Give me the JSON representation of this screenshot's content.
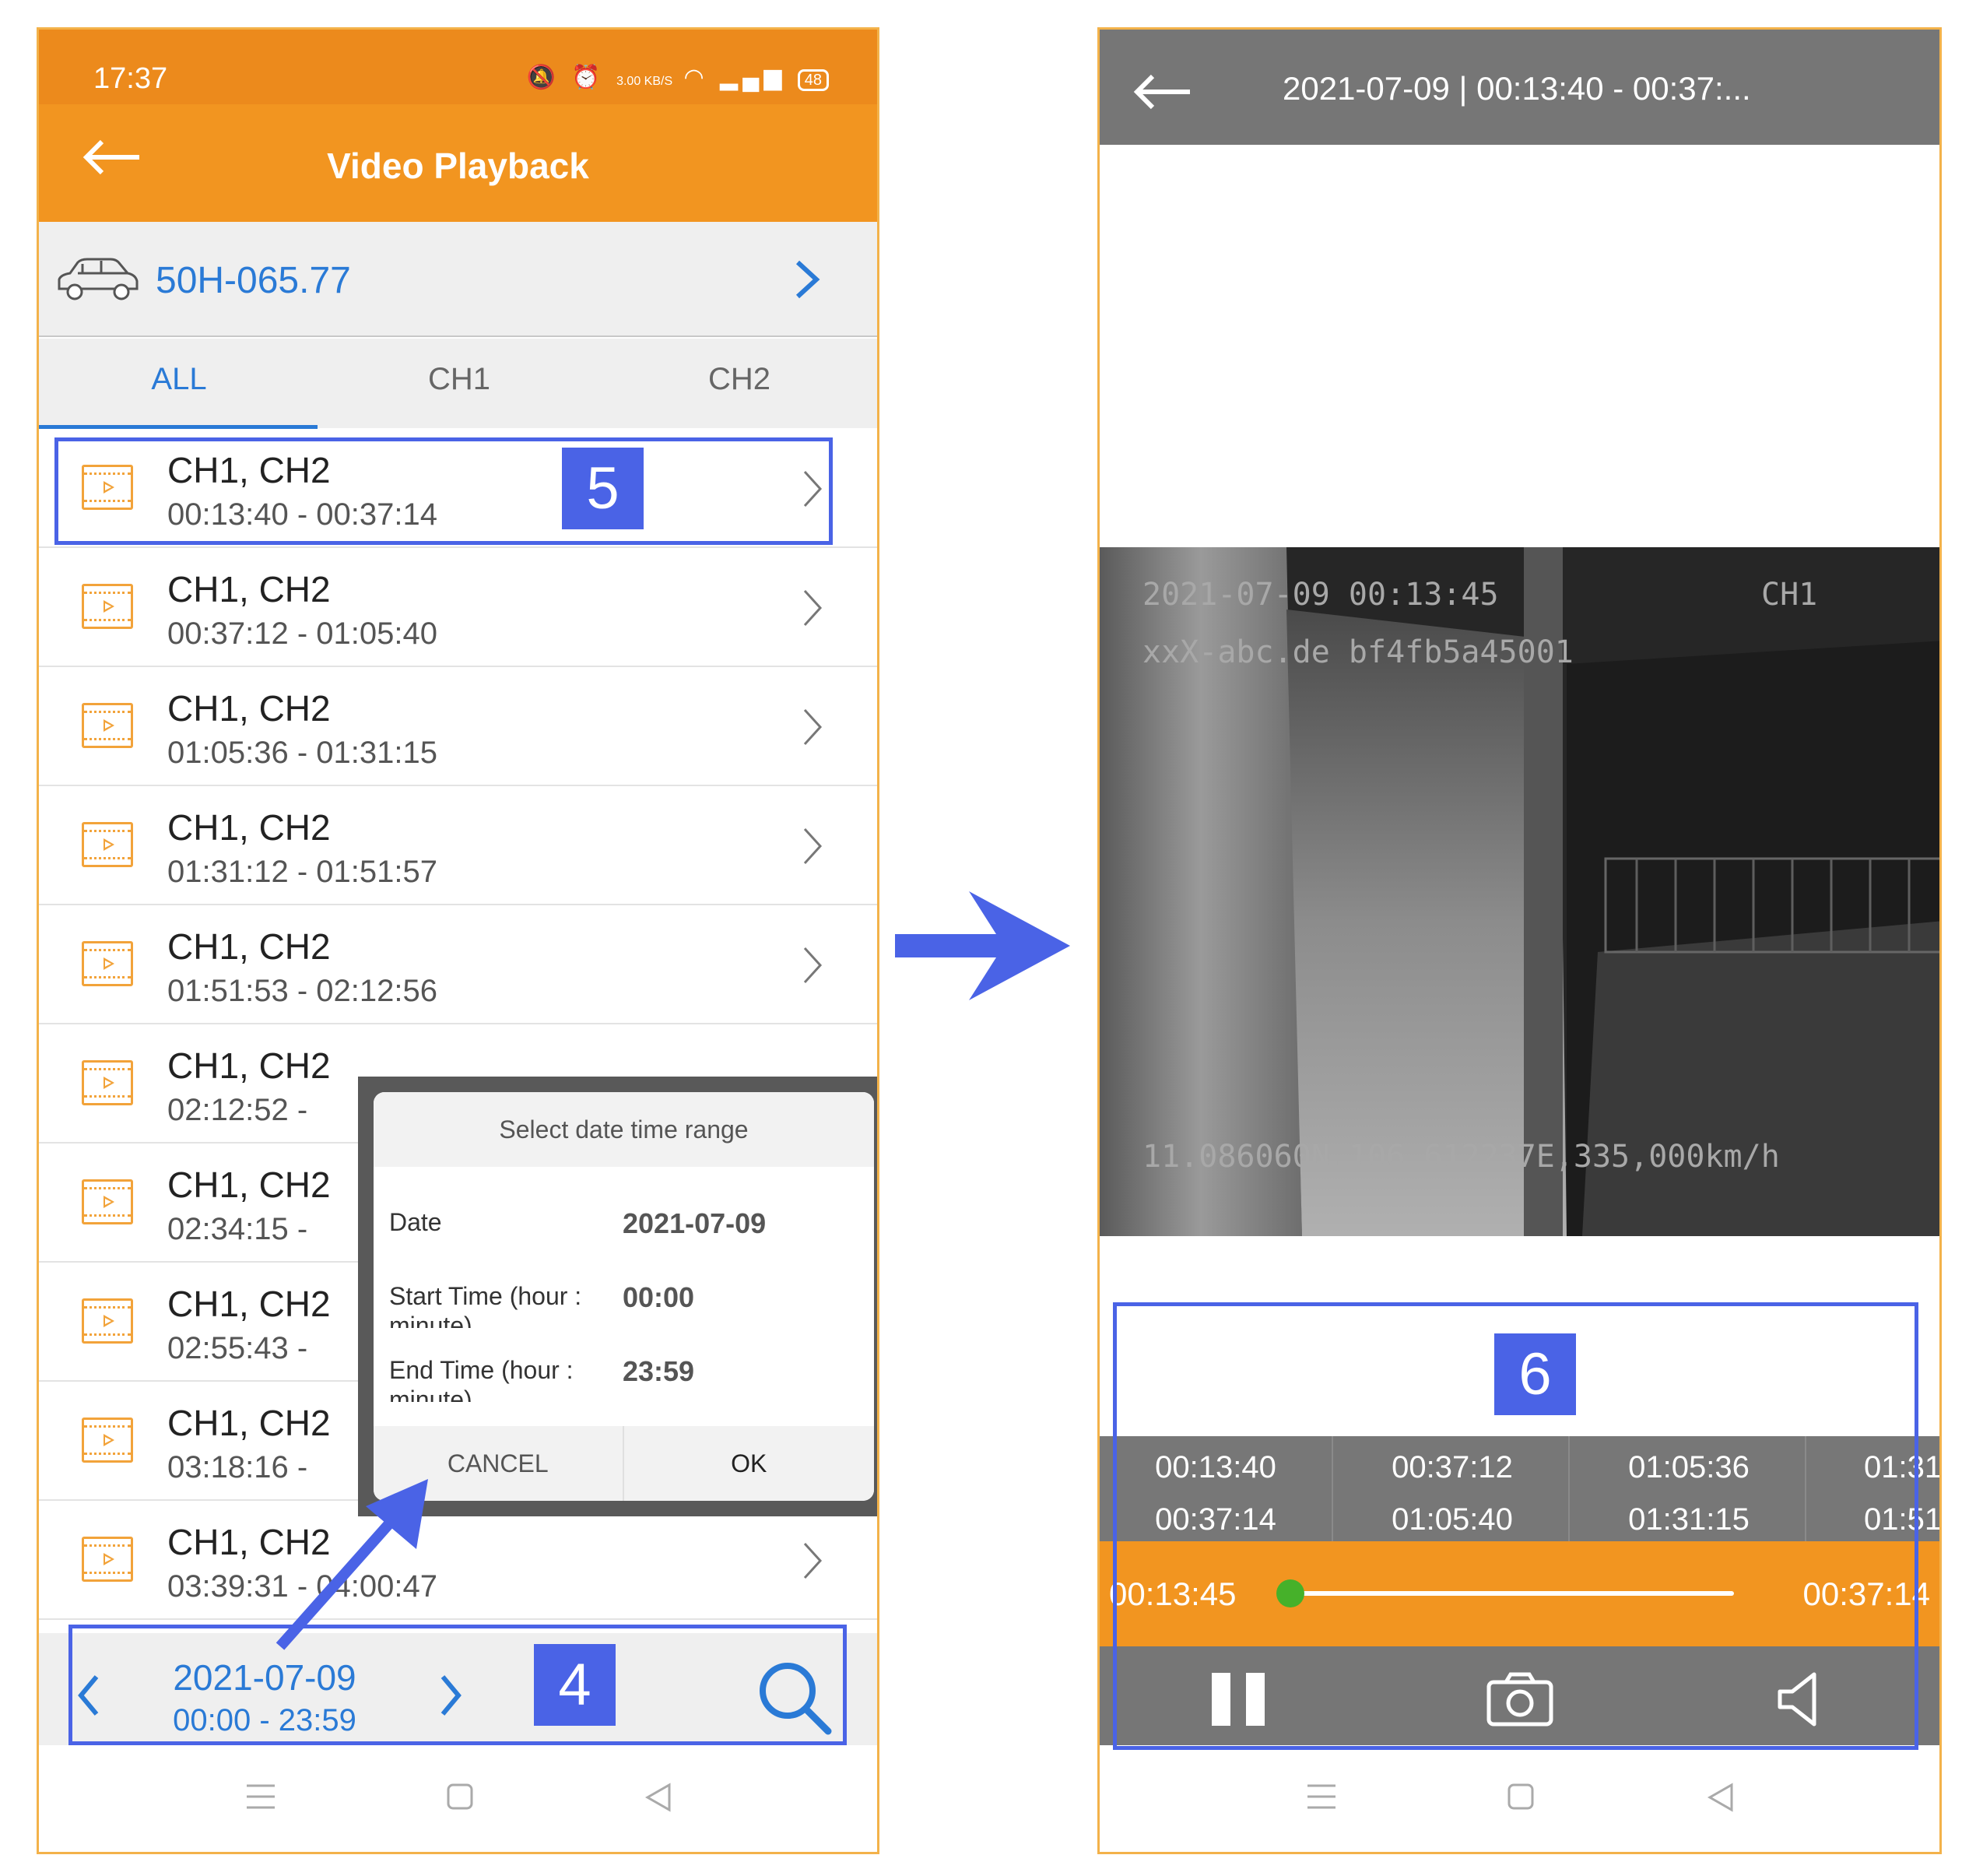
{
  "left_screen": {
    "status_bar": {
      "time": "17:37",
      "net_speed": "3.00 KB/S",
      "battery": "48"
    },
    "header": {
      "title": "Video Playback"
    },
    "vehicle": {
      "plate": "50H-065.77"
    },
    "tabs": [
      "ALL",
      "CH1",
      "CH2"
    ],
    "active_tab": "ALL",
    "recordings": [
      {
        "channels": "CH1, CH2",
        "range": "00:13:40 - 00:37:14"
      },
      {
        "channels": "CH1, CH2",
        "range": "00:37:12 - 01:05:40"
      },
      {
        "channels": "CH1, CH2",
        "range": "01:05:36 - 01:31:15"
      },
      {
        "channels": "CH1, CH2",
        "range": "01:31:12 - 01:51:57"
      },
      {
        "channels": "CH1, CH2",
        "range": "01:51:53 - 02:12:56"
      },
      {
        "channels": "CH1, CH2",
        "range": "02:12:52 -"
      },
      {
        "channels": "CH1, CH2",
        "range": "02:34:15 -"
      },
      {
        "channels": "CH1, CH2",
        "range": "02:55:43 -"
      },
      {
        "channels": "CH1, CH2",
        "range": "03:18:16 -"
      },
      {
        "channels": "CH1, CH2",
        "range": "03:39:31 - 04:00:47"
      }
    ],
    "date_filter": {
      "date": "2021-07-09",
      "range": "00:00 - 23:59"
    },
    "dialog": {
      "title": "Select date time range",
      "date_label": "Date",
      "date_value": "2021-07-09",
      "start_label": "Start Time (hour : minute)",
      "start_value": "00:00",
      "end_label": "End Time (hour : minute)",
      "end_value": "23:59",
      "cancel": "CANCEL",
      "ok": "OK"
    }
  },
  "right_screen": {
    "header": {
      "title": "2021-07-09 | 00:13:40 - 00:37:..."
    },
    "video_overlay": {
      "timestamp": "2021-07-09 00:13:45",
      "channel": "CH1",
      "device": "xxX-abc.de bf4fb5a45001",
      "gps": "11.086060N,106.612237E,335,000km/h"
    },
    "segments": [
      {
        "start": "00:13:40",
        "end": "00:37:14"
      },
      {
        "start": "00:37:12",
        "end": "01:05:40"
      },
      {
        "start": "01:05:36",
        "end": "01:31:15"
      },
      {
        "start": "01:31",
        "end": "01:51"
      }
    ],
    "seek": {
      "current": "00:13:45",
      "end": "00:37:14",
      "progress": 0.0
    }
  },
  "annotations": {
    "badge_4": "4",
    "badge_5": "5",
    "badge_6": "6"
  },
  "colors": {
    "accent_orange": "#f29520",
    "link_blue": "#2a7ad6",
    "annotation_blue": "#4a63e6",
    "seek_thumb": "#46b12a"
  }
}
